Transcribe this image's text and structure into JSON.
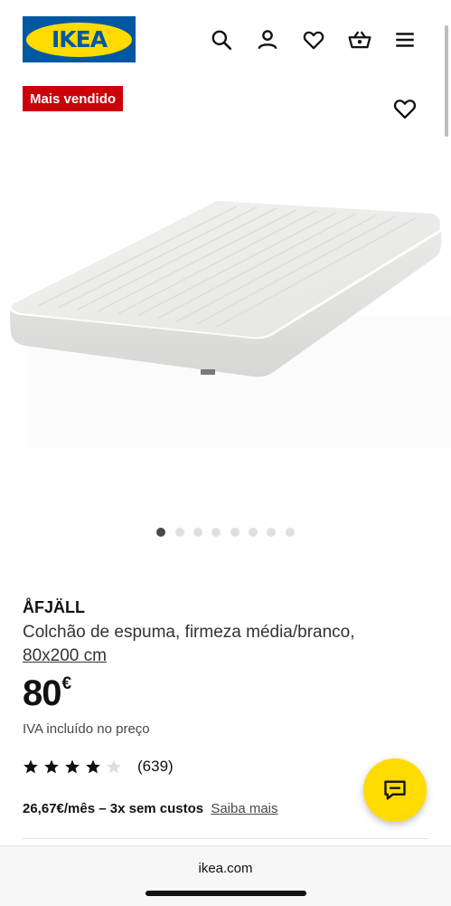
{
  "header": {
    "logo_text": "IKEA",
    "icons": [
      "search-icon",
      "user-icon",
      "heart-icon",
      "basket-icon",
      "menu-icon"
    ]
  },
  "badge": {
    "label": "Mais vendido",
    "color": "#cc0008"
  },
  "gallery": {
    "image_count": 8,
    "active_index": 0
  },
  "product": {
    "name": "ÅFJÄLL",
    "description": "Colchão de espuma, firmeza média/branco,",
    "size": "80x200 cm",
    "price": "80",
    "currency": "€",
    "vat_note": "IVA incluído no preço",
    "rating": 4,
    "rating_max": 5,
    "review_count": "(639)"
  },
  "installment": {
    "text": "26,67€/mês – 3x sem custos",
    "link": "Saiba mais"
  },
  "browser": {
    "url": "ikea.com"
  },
  "colors": {
    "brand_blue": "#0058a3",
    "brand_yellow": "#ffdb00",
    "badge_red": "#cc0008"
  }
}
